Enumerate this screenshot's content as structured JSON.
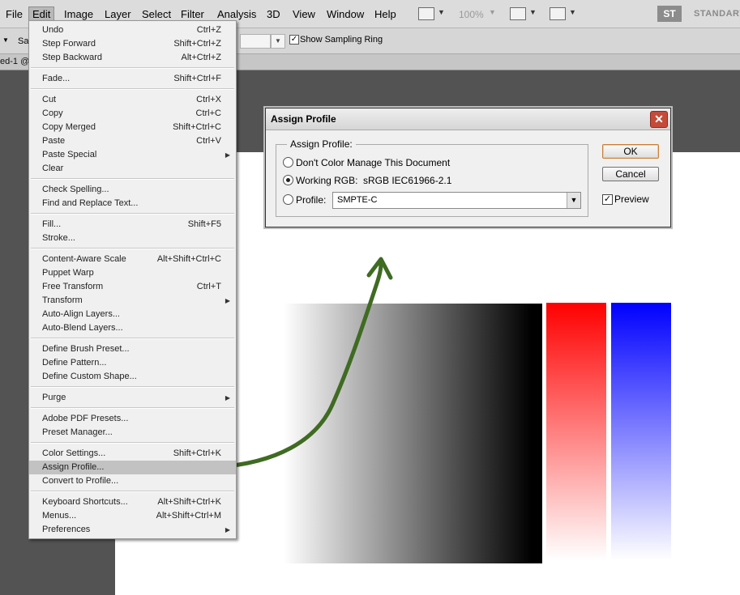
{
  "menubar": {
    "items": [
      "File",
      "Edit",
      "Image",
      "Layer",
      "Select",
      "Filter",
      "Analysis",
      "3D",
      "View",
      "Window",
      "Help"
    ],
    "zoom": "100%",
    "workspace_badge": "ST",
    "workspace_name": "STANDART"
  },
  "options_bar": {
    "sample_label": "Sa",
    "show_sampling_ring_label": "Show Sampling Ring",
    "show_sampling_ring_checked": true
  },
  "document_tab": {
    "title": "ed-1 @"
  },
  "edit_menu": {
    "highlighted_index": 30,
    "items": [
      {
        "label": "Undo",
        "shortcut": "Ctrl+Z"
      },
      {
        "label": "Step Forward",
        "shortcut": "Shift+Ctrl+Z"
      },
      {
        "label": "Step Backward",
        "shortcut": "Alt+Ctrl+Z"
      },
      {
        "label": "Fade...",
        "shortcut": "Shift+Ctrl+F"
      },
      {
        "label": "Cut",
        "shortcut": "Ctrl+X"
      },
      {
        "label": "Copy",
        "shortcut": "Ctrl+C"
      },
      {
        "label": "Copy Merged",
        "shortcut": "Shift+Ctrl+C"
      },
      {
        "label": "Paste",
        "shortcut": "Ctrl+V"
      },
      {
        "label": "Paste Special",
        "shortcut": "",
        "submenu": true
      },
      {
        "label": "Clear",
        "shortcut": ""
      },
      {
        "label": "Check Spelling...",
        "shortcut": ""
      },
      {
        "label": "Find and Replace Text...",
        "shortcut": ""
      },
      {
        "label": "Fill...",
        "shortcut": "Shift+F5"
      },
      {
        "label": "Stroke...",
        "shortcut": ""
      },
      {
        "label": "Content-Aware Scale",
        "shortcut": "Alt+Shift+Ctrl+C"
      },
      {
        "label": "Puppet Warp",
        "shortcut": ""
      },
      {
        "label": "Free Transform",
        "shortcut": "Ctrl+T"
      },
      {
        "label": "Transform",
        "shortcut": "",
        "submenu": true
      },
      {
        "label": "Auto-Align Layers...",
        "shortcut": ""
      },
      {
        "label": "Auto-Blend Layers...",
        "shortcut": ""
      },
      {
        "label": "Define Brush Preset...",
        "shortcut": ""
      },
      {
        "label": "Define Pattern...",
        "shortcut": ""
      },
      {
        "label": "Define Custom Shape...",
        "shortcut": ""
      },
      {
        "label": "Purge",
        "shortcut": "",
        "submenu": true
      },
      {
        "label": "Adobe PDF Presets...",
        "shortcut": ""
      },
      {
        "label": "Preset Manager...",
        "shortcut": ""
      },
      {
        "label": "Color Settings...",
        "shortcut": "Shift+Ctrl+K"
      },
      {
        "label": "Assign Profile...",
        "shortcut": ""
      },
      {
        "label": "Convert to Profile...",
        "shortcut": ""
      },
      {
        "label": "Keyboard Shortcuts...",
        "shortcut": "Alt+Shift+Ctrl+K"
      },
      {
        "label": "Menus...",
        "shortcut": "Alt+Shift+Ctrl+M"
      },
      {
        "label": "Preferences",
        "shortcut": "",
        "submenu": true
      }
    ]
  },
  "dialog": {
    "title": "Assign Profile",
    "group_label": "Assign Profile:",
    "option_dont_manage": "Don't Color Manage This Document",
    "option_working_rgb_label": "Working RGB:",
    "option_working_rgb_value": "sRGB IEC61966-2.1",
    "option_profile_label": "Profile:",
    "selected_option": "working_rgb",
    "profile_value": "SMPTE-C",
    "ok_label": "OK",
    "cancel_label": "Cancel",
    "preview_label": "Preview",
    "preview_checked": true
  },
  "colors": {
    "workspace_bg": "#535353",
    "canvas_bg": "#ffffff",
    "menu_highlight": "#c2c2c2",
    "arrow": "#3f6b22",
    "gradient_red": "#ff0000",
    "gradient_blue": "#0000ff"
  }
}
